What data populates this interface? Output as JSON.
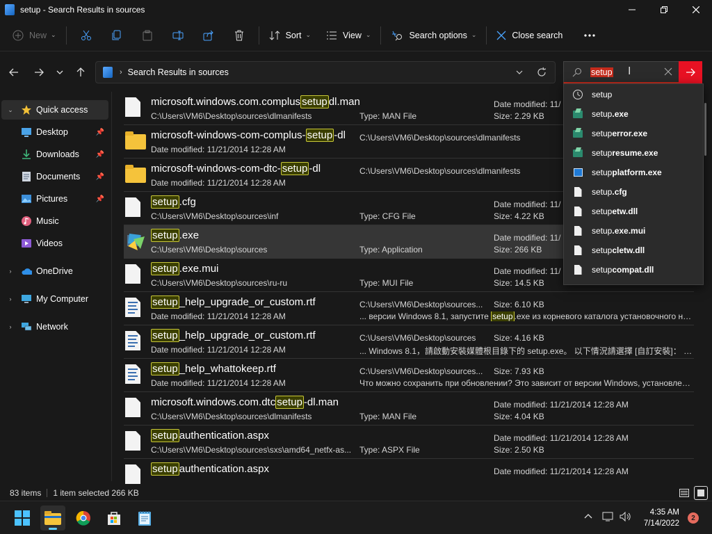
{
  "window": {
    "title": "setup - Search Results in sources"
  },
  "toolbar": {
    "new": "New",
    "sort": "Sort",
    "view": "View",
    "search_options": "Search options",
    "close_search": "Close search"
  },
  "address": {
    "breadcrumb": "Search Results in sources"
  },
  "search": {
    "query": "setup"
  },
  "sidebar": {
    "quick_access": "Quick access",
    "desktop": "Desktop",
    "downloads": "Downloads",
    "documents": "Documents",
    "pictures": "Pictures",
    "music": "Music",
    "videos": "Videos",
    "onedrive": "OneDrive",
    "my_computer": "My Computer",
    "network": "Network"
  },
  "suggestions": [
    {
      "icon": "history",
      "text": "setup"
    },
    {
      "icon": "exe",
      "text": "setup.exe"
    },
    {
      "icon": "exe",
      "text": "setuperror.exe"
    },
    {
      "icon": "exe",
      "text": "setupresume.exe"
    },
    {
      "icon": "win",
      "text": "setupplatform.exe"
    },
    {
      "icon": "doc",
      "text": "setup.cfg"
    },
    {
      "icon": "dll",
      "text": "setupetw.dll"
    },
    {
      "icon": "doc",
      "text": "setup.exe.mui"
    },
    {
      "icon": "dll",
      "text": "setupcletw.dll"
    },
    {
      "icon": "dll",
      "text": "setupcompat.dll"
    }
  ],
  "files": [
    {
      "icon": "doc",
      "name": [
        "microsoft.windows.com.complus",
        "setup",
        "dl.man"
      ],
      "sub1": "C:\\Users\\VM6\\Desktop\\sources\\dlmanifests",
      "col2a": "",
      "col2b": "Type: MAN File",
      "col3a": "Date modified: 11/",
      "col3b": "Size: 2.29 KB",
      "snippet": []
    },
    {
      "icon": "folder",
      "name": [
        "microsoft-windows-com-complus-",
        "setup",
        "-dl"
      ],
      "sub1": "Date modified: 11/21/2014 12:28 AM",
      "col2a": "C:\\Users\\VM6\\Desktop\\sources\\dlmanifests",
      "col2b": "",
      "col3a": "",
      "col3b": "",
      "snippet": []
    },
    {
      "icon": "folder",
      "name": [
        "microsoft-windows-com-dtc-",
        "setup",
        "-dl"
      ],
      "sub1": "Date modified: 11/21/2014 12:28 AM",
      "col2a": "C:\\Users\\VM6\\Desktop\\sources\\dlmanifests",
      "col2b": "",
      "col3a": "",
      "col3b": "",
      "snippet": []
    },
    {
      "icon": "doc",
      "name": [
        "",
        "setup",
        ".cfg"
      ],
      "sub1": "C:\\Users\\VM6\\Desktop\\sources\\inf",
      "col2a": "",
      "col2b": "Type: CFG File",
      "col3a": "Date modified: 11/",
      "col3b": "Size: 4.22 KB",
      "snippet": []
    },
    {
      "icon": "setup",
      "name": [
        "",
        "setup",
        ".exe"
      ],
      "sub1": "C:\\Users\\VM6\\Desktop\\sources",
      "col2a": "",
      "col2b": "Type: Application",
      "col3a": "Date modified: 11/",
      "col3b": "Size: 266 KB",
      "snippet": [],
      "selected": true
    },
    {
      "icon": "doc",
      "name": [
        "",
        "setup",
        ".exe.mui"
      ],
      "sub1": "C:\\Users\\VM6\\Desktop\\sources\\ru-ru",
      "col2a": "",
      "col2b": "Type: MUI File",
      "col3a": "Date modified: 11/",
      "col3b": "Size: 14.5 KB",
      "snippet": []
    },
    {
      "icon": "rtf",
      "name": [
        "",
        "setup",
        "_help_upgrade_or_custom.rtf"
      ],
      "sub1": "Date modified: 11/21/2014 12:28 AM",
      "col2a": "C:\\Users\\VM6\\Desktop\\sources...",
      "col2b": "",
      "col3a": "Size: 6.10 KB",
      "col3b": "",
      "snippet": [
        "... версии Windows 8.1, запустите ",
        "setup",
        ".exe из корневого каталога установочного нос..."
      ]
    },
    {
      "icon": "rtf",
      "name": [
        "",
        "setup",
        "_help_upgrade_or_custom.rtf"
      ],
      "sub1": "Date modified: 11/21/2014 12:28 AM",
      "col2a": "C:\\Users\\VM6\\Desktop\\sources",
      "col2b": "",
      "col3a": "Size: 4.16 KB",
      "col3b": "",
      "snippet": [
        "... Windows 8.1，請啟動安裝媒體根目錄下的 setup.exe。 以下情況請選擇 [自訂安裝]： 想..."
      ]
    },
    {
      "icon": "rtf",
      "name": [
        "",
        "setup",
        "_help_whattokeep.rtf"
      ],
      "sub1": "Date modified: 11/21/2014 12:28 AM",
      "col2a": "C:\\Users\\VM6\\Desktop\\sources...",
      "col2b": "",
      "col3a": "Size: 7.93 KB",
      "col3b": "",
      "snippet": [
        "Что можно сохранить при обновлении? Это зависит от версии Windows, установлен..."
      ]
    },
    {
      "icon": "doc",
      "name": [
        "microsoft.windows.com.dtc",
        "setup",
        "-dl.man"
      ],
      "sub1": "C:\\Users\\VM6\\Desktop\\sources\\dlmanifests",
      "col2a": "",
      "col2b": "Type: MAN File",
      "col3a": "Date modified: 11/21/2014 12:28 AM",
      "col3b": "Size: 4.04 KB",
      "snippet": []
    },
    {
      "icon": "doc",
      "name": [
        "",
        "setup",
        "authentication.aspx"
      ],
      "sub1": "C:\\Users\\VM6\\Desktop\\sources\\sxs\\amd64_netfx-as...",
      "col2a": "",
      "col2b": "Type: ASPX File",
      "col3a": "Date modified: 11/21/2014 12:28 AM",
      "col3b": "Size: 2.50 KB",
      "snippet": []
    },
    {
      "icon": "doc",
      "name": [
        "",
        "setup",
        "authentication.aspx"
      ],
      "sub1": "",
      "col2a": "",
      "col2b": "",
      "col3a": "Date modified: 11/21/2014 12:28 AM",
      "col3b": "",
      "snippet": []
    }
  ],
  "status": {
    "count": "83 items",
    "selection": "1 item selected  266 KB"
  },
  "taskbar": {
    "time": "4:35 AM",
    "date": "7/14/2022",
    "notifications": "2"
  },
  "colors": {
    "accent_red": "#e81123",
    "highlight_border": "#c9c83a",
    "background": "#191919"
  }
}
